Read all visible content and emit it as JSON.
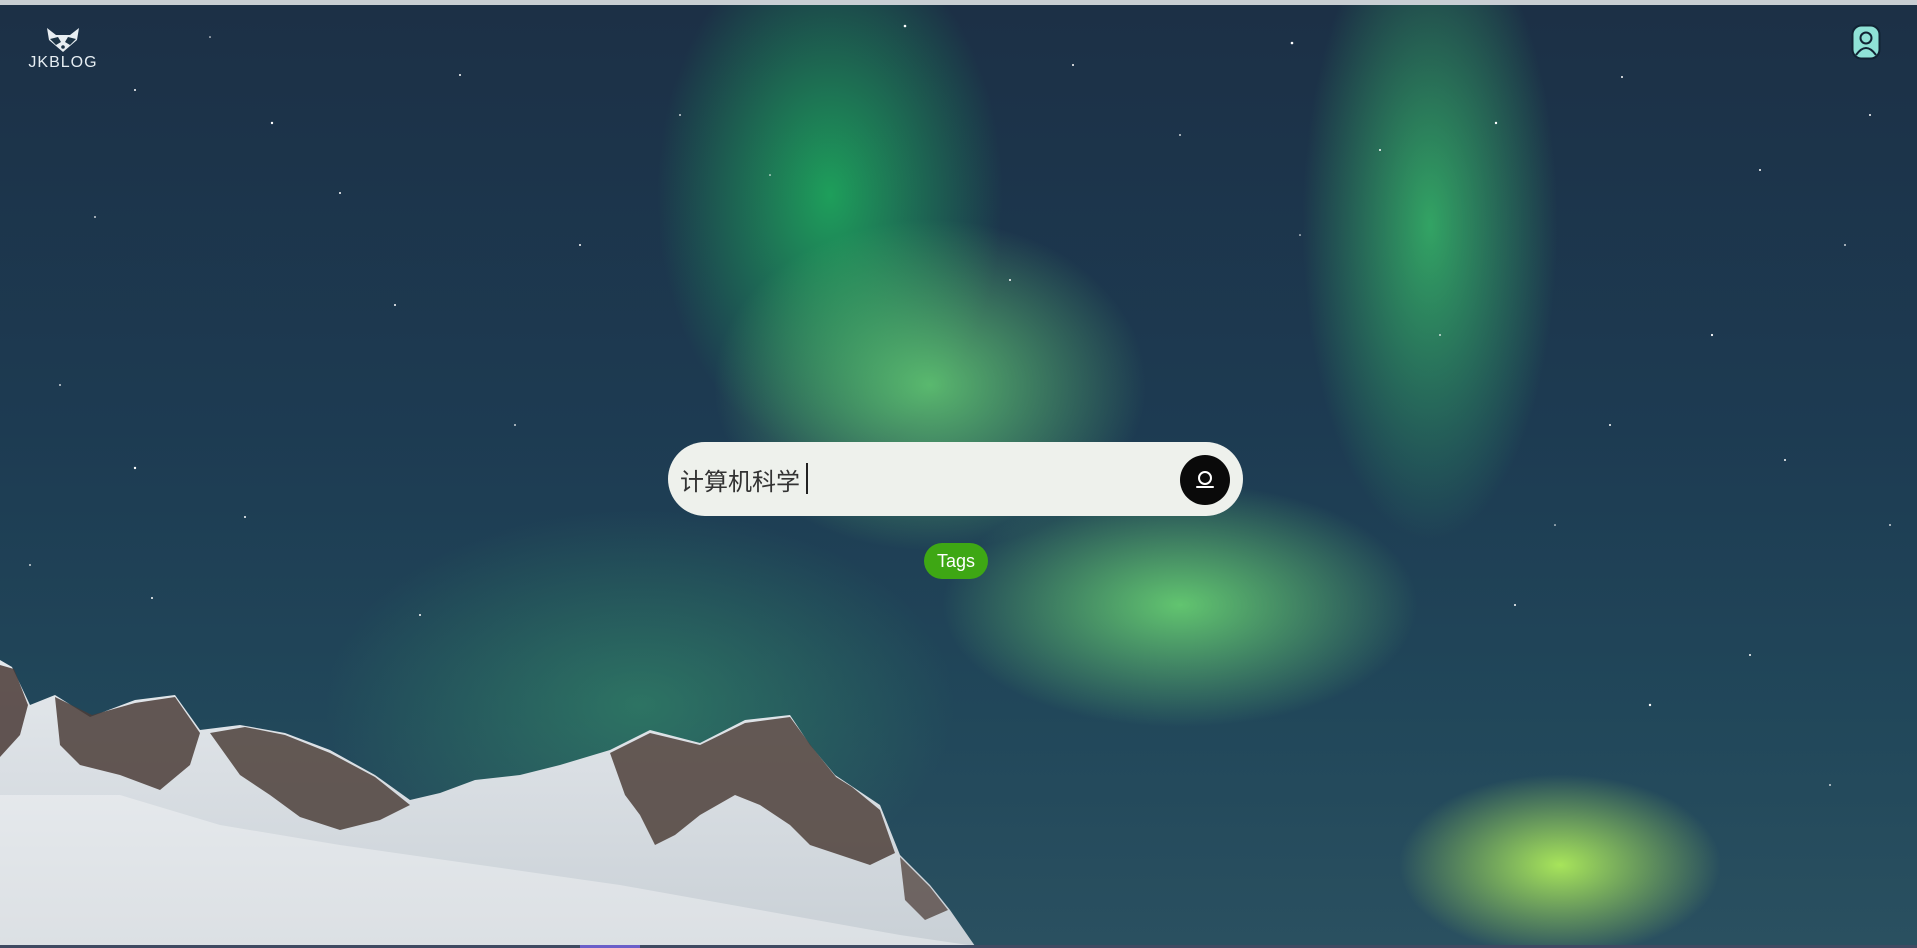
{
  "header": {
    "logo_text": "JKBLOG",
    "logo_icon": "raccoon-icon",
    "user_icon": "user-icon"
  },
  "search": {
    "value": "计算机科学",
    "icon": "search-icon"
  },
  "tags_button": {
    "label": "Tags"
  },
  "colors": {
    "search_bg": "#eef1ec",
    "search_button": "#0a0a0a",
    "tags_button": "#3ea714",
    "brand_text": "#e6eef3"
  }
}
